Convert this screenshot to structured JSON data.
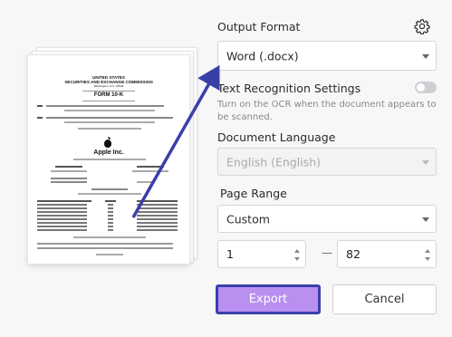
{
  "output_format": {
    "label": "Output Format",
    "value": "Word (.docx)"
  },
  "text_recognition": {
    "label": "Text Recognition Settings",
    "hint": "Turn on the OCR when the document appears to be scanned.",
    "enabled": false
  },
  "document_language": {
    "label": "Document Language",
    "value": "English (English)"
  },
  "page_range": {
    "label": "Page Range",
    "mode": "Custom",
    "from": "1",
    "to": "82",
    "separator": "—"
  },
  "buttons": {
    "export": "Export",
    "cancel": "Cancel"
  },
  "icons": {
    "settings": "gear-icon"
  },
  "colors": {
    "export_bg": "#b98ff0",
    "highlight_border": "#3a3fa8",
    "arrow": "#3a3fa8"
  },
  "preview": {
    "org_line1": "UNITED STATES",
    "org_line2": "SECURITIES AND EXCHANGE COMMISSION",
    "org_line3": "Washington, D.C. 20549",
    "form_title": "FORM 10-K",
    "company": "Apple Inc."
  }
}
